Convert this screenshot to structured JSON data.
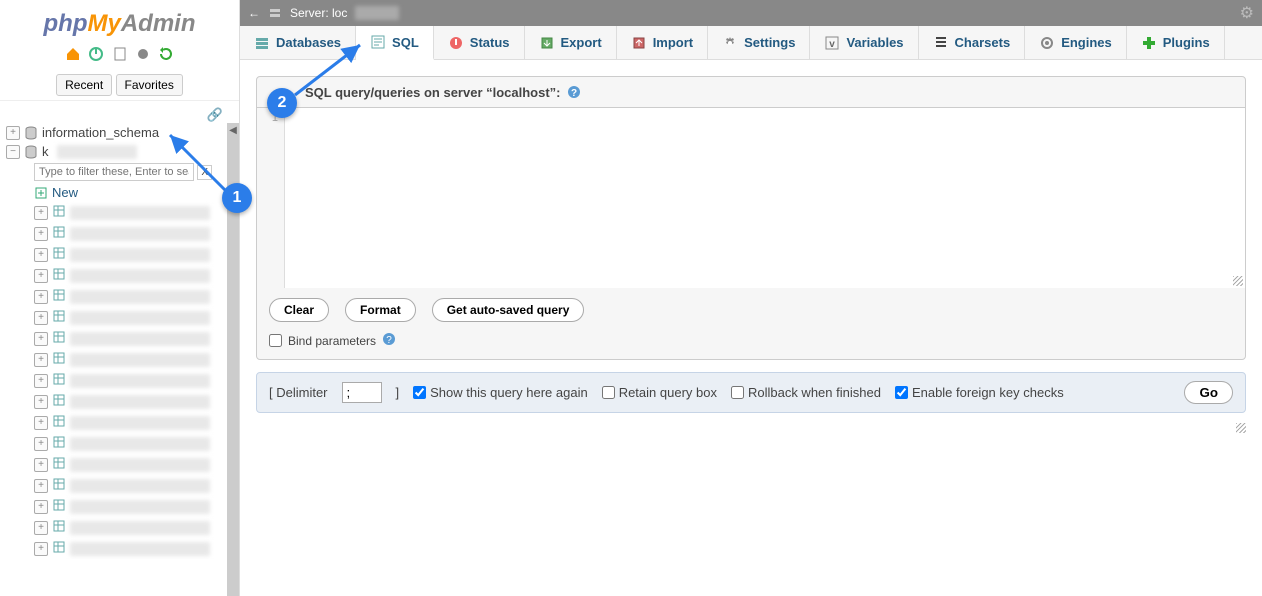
{
  "logo": {
    "php": "php",
    "my": "My",
    "admin": "Admin"
  },
  "sidebar": {
    "recent": "Recent",
    "favorites": "Favorites",
    "db1": "information_schema",
    "db2_prefix": "k",
    "filter_placeholder": "Type to filter these, Enter to search",
    "new_label": "New"
  },
  "topbar": {
    "server_label": "Server: loc"
  },
  "tabs": [
    {
      "id": "databases",
      "label": "Databases"
    },
    {
      "id": "sql",
      "label": "SQL"
    },
    {
      "id": "status",
      "label": "Status"
    },
    {
      "id": "export",
      "label": "Export"
    },
    {
      "id": "import",
      "label": "Import"
    },
    {
      "id": "settings",
      "label": "Settings"
    },
    {
      "id": "variables",
      "label": "Variables"
    },
    {
      "id": "charsets",
      "label": "Charsets"
    },
    {
      "id": "engines",
      "label": "Engines"
    },
    {
      "id": "plugins",
      "label": "Plugins"
    }
  ],
  "query": {
    "header_prefix": "SQL query/queries on server “localhost”:",
    "line1": "1",
    "clear": "Clear",
    "format": "Format",
    "get_autosaved": "Get auto-saved query",
    "bind": "Bind parameters"
  },
  "options": {
    "delimiter_label": "[ Delimiter",
    "delimiter_value": ";",
    "delimiter_close": "]",
    "show_again": "Show this query here again",
    "retain": "Retain query box",
    "rollback": "Rollback when finished",
    "fk": "Enable foreign key checks",
    "go": "Go"
  },
  "callouts": {
    "c1": "1",
    "c2": "2"
  }
}
